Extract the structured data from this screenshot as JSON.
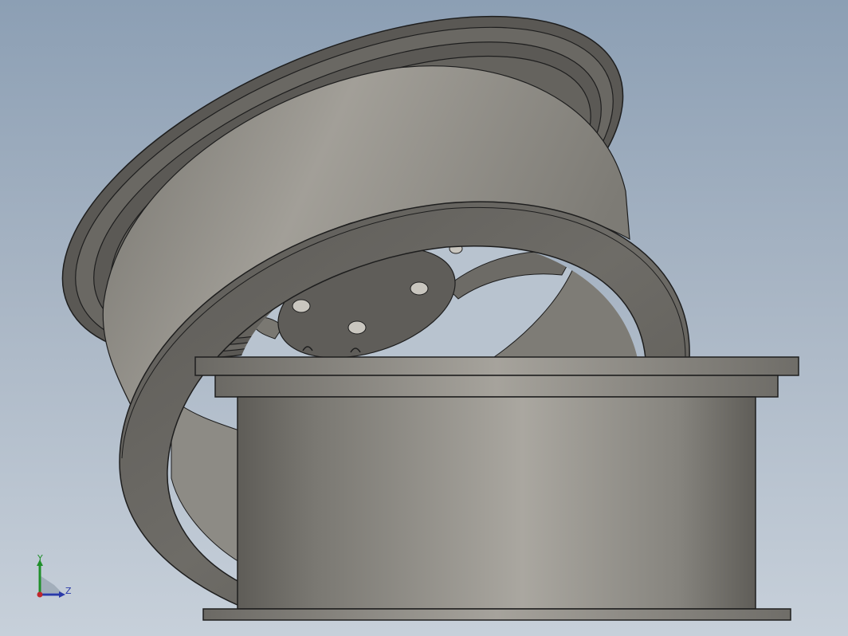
{
  "viewport": {
    "background_top": "#8c9fb4",
    "background_bottom": "#c7d0da",
    "model_color": "#8f8d86",
    "edge_color": "#1e1e1e"
  },
  "triad": {
    "y_label": "Y",
    "z_label": "Z",
    "y_color": "#1f8f2a",
    "z_color": "#2a3aa8",
    "origin_color": "#c0282c"
  }
}
